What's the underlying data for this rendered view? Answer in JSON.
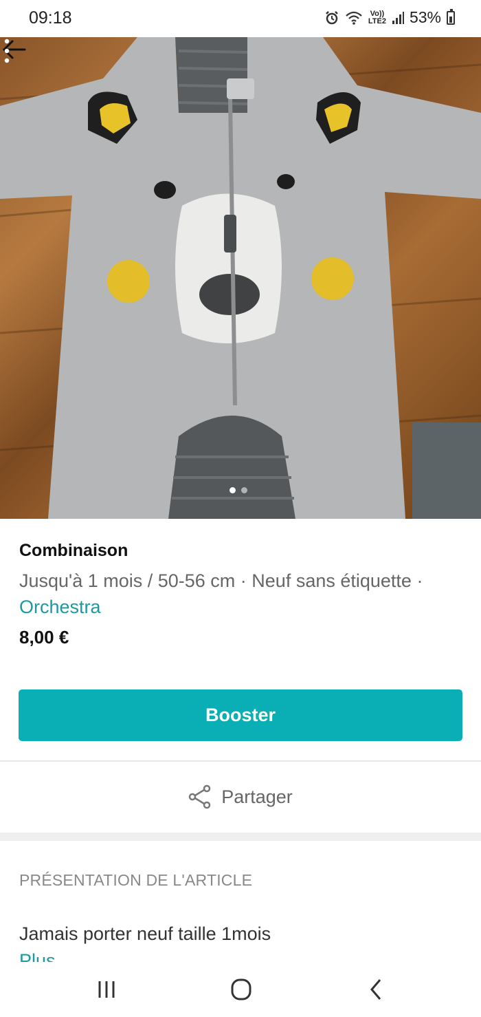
{
  "status_bar": {
    "time": "09:18",
    "alarm_icon": "alarm-icon",
    "wifi_icon": "wifi-icon",
    "volte_top": "Vo))",
    "volte_bottom": "LTE2",
    "signal_icon": "signal-bars-icon",
    "battery": "53%"
  },
  "photo": {
    "back_icon": "arrow-left-icon",
    "more_icon": "more-vertical-icon",
    "page_count": 2,
    "active_page": 1
  },
  "item": {
    "title": "Combinaison",
    "size": "Jusqu'à 1 mois / 50-56 cm",
    "separator": " · ",
    "condition": "Neuf sans étiquette",
    "brand": "Orchestra",
    "price": "8,00 €"
  },
  "actions": {
    "booster_label": "Booster",
    "share_label": "Partager",
    "share_icon": "share-icon"
  },
  "description": {
    "heading": "PRÉSENTATION DE L'ARTICLE",
    "text": "Jamais porter neuf taille 1mois",
    "more_label": "Plus"
  },
  "nav": {
    "recents_icon": "recent-apps-icon",
    "home_icon": "home-circle-icon",
    "back_icon": "nav-back-icon"
  },
  "colors": {
    "accent": "#0aaeb5",
    "brand_link": "#1a9aa0"
  }
}
